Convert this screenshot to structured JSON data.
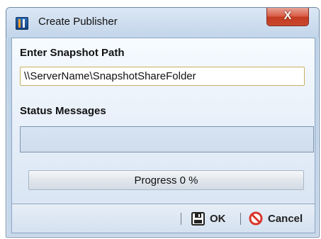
{
  "window": {
    "title": "Create Publisher",
    "close_glyph": "X"
  },
  "snapshot": {
    "label": "Enter Snapshot Path",
    "path_value": "\\\\ServerName\\SnapshotShareFolder"
  },
  "status": {
    "label": "Status Messages",
    "messages": ""
  },
  "progress": {
    "label": "Progress 0 %",
    "percent": 0
  },
  "footer": {
    "ok_label": "OK",
    "cancel_label": "Cancel"
  },
  "icons": {
    "app": "publisher-icon",
    "ok": "floppy-disk-icon",
    "cancel": "prohibited-icon"
  },
  "colors": {
    "close_button": "#d95b43",
    "input_border": "#c7b062",
    "cancel_icon": "#d9362b"
  }
}
